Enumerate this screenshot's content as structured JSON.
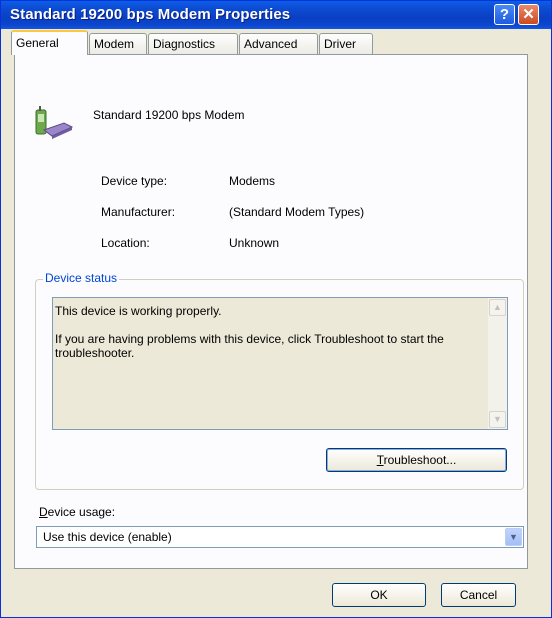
{
  "window": {
    "title": "Standard 19200 bps Modem Properties",
    "help_glyph": "?",
    "close_glyph": "✕"
  },
  "tabs": [
    {
      "label": "General",
      "active": true
    },
    {
      "label": "Modem",
      "active": false
    },
    {
      "label": "Diagnostics",
      "active": false
    },
    {
      "label": "Advanced",
      "active": false
    },
    {
      "label": "Driver",
      "active": false
    }
  ],
  "device": {
    "icon": "modem-icon",
    "name": "Standard 19200 bps Modem"
  },
  "properties": [
    {
      "label": "Device type:",
      "value": "Modems"
    },
    {
      "label": "Manufacturer:",
      "value": "(Standard Modem Types)"
    },
    {
      "label": "Location:",
      "value": "Unknown"
    }
  ],
  "status": {
    "group_label": "Device status",
    "line1": "This device is working properly.",
    "line2": "If you are having problems with this device, click Troubleshoot to start the troubleshooter.",
    "troubleshoot_mnemonic": "T",
    "troubleshoot_rest": "roubleshoot..."
  },
  "usage": {
    "label_mnemonic": "D",
    "label_rest": "evice usage:",
    "selected": "Use this device (enable)"
  },
  "buttons": {
    "ok": "OK",
    "cancel": "Cancel"
  },
  "colors": {
    "title_bar": "#0a3fc4",
    "group_label": "#0046d5",
    "active_tab_accent": "#ffc83c",
    "dialog_face": "#ece9d8"
  }
}
